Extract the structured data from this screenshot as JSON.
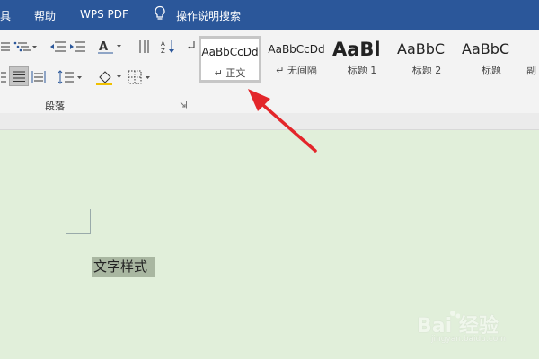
{
  "menubar": {
    "items": [
      "具",
      "帮助",
      "WPS PDF",
      "操作说明搜索"
    ],
    "search_icon": "lightbulb-icon"
  },
  "ribbon": {
    "paragraph_group_label": "段落",
    "styles": [
      {
        "sample": "AaBbCcDd",
        "name": "正文",
        "selected": true
      },
      {
        "sample": "AaBbCcDd",
        "name": "无间隔",
        "selected": false
      },
      {
        "sample": "AaBl",
        "name": "标题 1",
        "selected": false
      },
      {
        "sample": "AaBbC",
        "name": "标题 2",
        "selected": false
      },
      {
        "sample": "AaBbC",
        "name": "标题",
        "selected": false
      },
      {
        "sample": "",
        "name": "副",
        "selected": false
      }
    ]
  },
  "document": {
    "text": "文字样式"
  },
  "watermark": {
    "brand": "Bai 经验",
    "url": "jingyan.baidu.com"
  },
  "colors": {
    "menubar": "#2b579a",
    "document_background": "#e1efda",
    "selection": "#a9b7a1",
    "arrow": "#e3262a"
  }
}
